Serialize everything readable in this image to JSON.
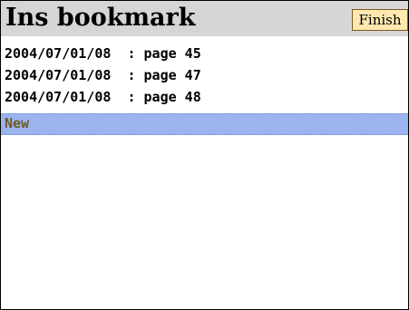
{
  "header": {
    "title": "Ins bookmark",
    "finish_label": "Finish"
  },
  "bookmarks": [
    {
      "label": "2004/07/01/08  : page 45"
    },
    {
      "label": "2004/07/01/08  : page 47"
    },
    {
      "label": "2004/07/01/08  : page 48"
    }
  ],
  "new_item": {
    "label": "New",
    "state": "selected"
  },
  "colors": {
    "titlebar_bg": "#d6d6d6",
    "finish_button_bg": "#ffe7b0",
    "selection_bg": "#9bb4f0",
    "new_text": "#6e5a22"
  }
}
